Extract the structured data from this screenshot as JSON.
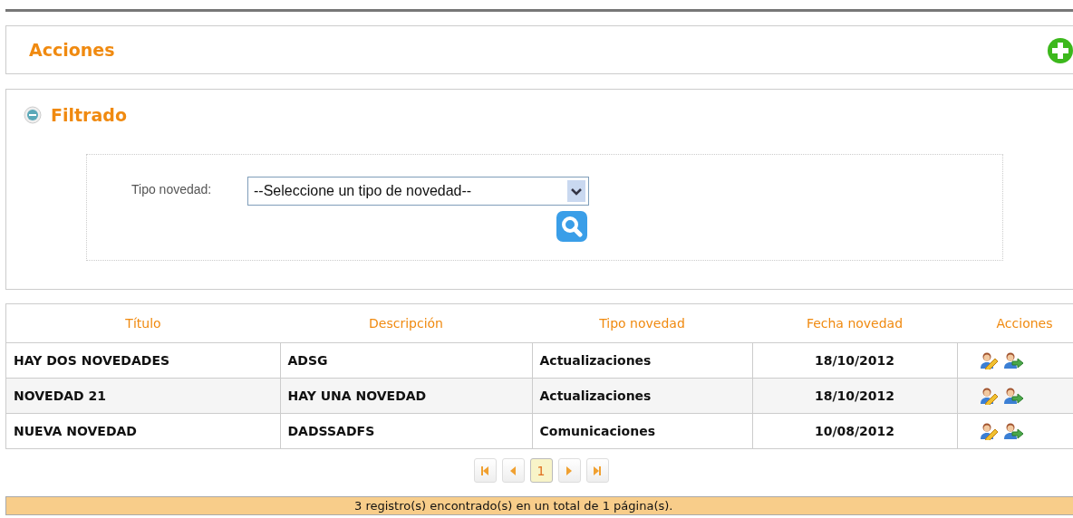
{
  "actions_panel": {
    "title": "Acciones"
  },
  "filter_panel": {
    "title": "Filtrado",
    "expanded": true,
    "field_label": "Tipo novedad:",
    "select_value": "--Seleccione un tipo de novedad--"
  },
  "table": {
    "columns": [
      "Título",
      "Descripción",
      "Tipo novedad",
      "Fecha novedad",
      "Acciones"
    ],
    "rows": [
      {
        "titulo": "HAY DOS NOVEDADES",
        "descripcion": "ADSG",
        "tipo": "Actualizaciones",
        "fecha": "18/10/2012"
      },
      {
        "titulo": "NOVEDAD 21",
        "descripcion": "HAY UNA NOVEDAD",
        "tipo": "Actualizaciones",
        "fecha": "18/10/2012"
      },
      {
        "titulo": "NUEVA NOVEDAD",
        "descripcion": "DADSSADFS",
        "tipo": "Comunicaciones",
        "fecha": "10/08/2012"
      }
    ]
  },
  "pagination": {
    "pages": [
      {
        "label": "1",
        "selected": true
      }
    ]
  },
  "status_bar": "3 registro(s) encontrado(s) en un total de 1 página(s)."
}
